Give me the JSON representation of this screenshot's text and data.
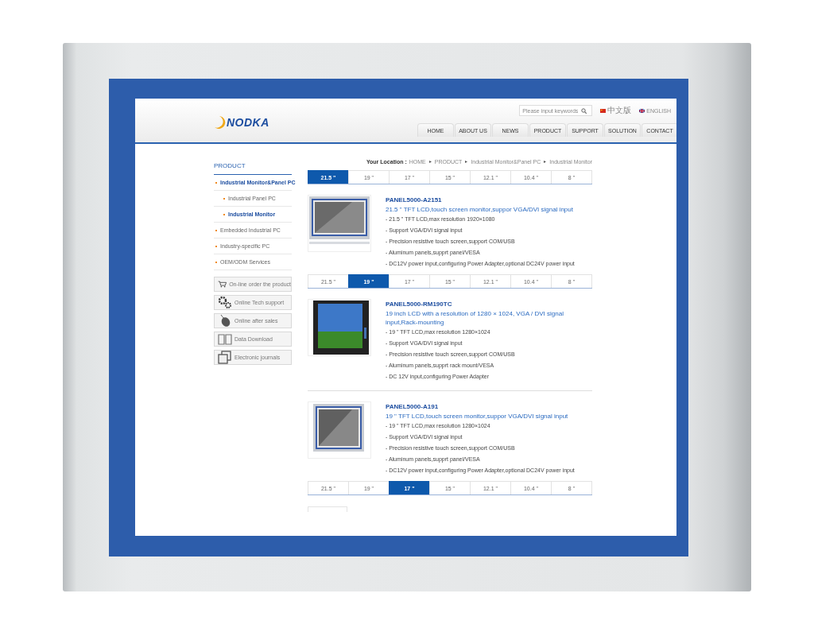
{
  "header": {
    "logo": "NODKA",
    "search": {
      "placeholder": "Please input keywords"
    },
    "languages": [
      {
        "label": "中文版"
      },
      {
        "label": "ENGLISH"
      }
    ],
    "nav": [
      {
        "label": "HOME",
        "selected": false
      },
      {
        "label": "ABOUT US",
        "selected": false
      },
      {
        "label": "NEWS",
        "selected": false
      },
      {
        "label": "PRODUCT",
        "selected": false
      },
      {
        "label": "SUPPORT",
        "selected": false
      },
      {
        "label": "SOLUTION",
        "selected": false
      },
      {
        "label": "CONTACT",
        "selected": false
      }
    ]
  },
  "sidebar": {
    "title": "PRODUCT",
    "items": [
      {
        "label": "Industrial Monitor&Panel PC",
        "selected": true,
        "children": [
          {
            "label": "Industrial Panel PC",
            "selected": false
          },
          {
            "label": "Industrial Monitor",
            "selected": true
          }
        ]
      },
      {
        "label": "Embedded Industrial PC",
        "selected": false
      },
      {
        "label": "Industry-specific PC",
        "selected": false
      },
      {
        "label": "OEM/ODM Services",
        "selected": false
      }
    ],
    "links": [
      {
        "label": "On-line order the product",
        "kind": "cart"
      },
      {
        "label": "Online Tech support",
        "kind": "gears"
      },
      {
        "label": "Online after sales",
        "kind": "mouse"
      },
      {
        "label": "Data Download",
        "kind": "book"
      },
      {
        "label": "Electronic journals",
        "kind": "pages"
      }
    ]
  },
  "breadcrumb": {
    "label": "Your Location :",
    "items": [
      "HOME",
      "PRODUCT",
      "Industrial Monitor&Panel PC",
      "Industrial Monitor"
    ]
  },
  "blocks": [
    {
      "kind": "tabs",
      "tabs": [
        {
          "label": "21.5 \"",
          "selected": true
        },
        {
          "label": "19 \"",
          "selected": false
        },
        {
          "label": "17 \"",
          "selected": false
        },
        {
          "label": "15 \"",
          "selected": false
        },
        {
          "label": "12.1 \"",
          "selected": false
        },
        {
          "label": "10.4 \"",
          "selected": false
        },
        {
          "label": "8 \"",
          "selected": false
        }
      ]
    },
    {
      "kind": "product",
      "model": "PANEL5000-A2151",
      "title": "21.5 \" TFT LCD,touch screen monitor,suppor VGA/DVI signal input",
      "specs": [
        "- 21.5 \" TFT LCD,max resolution 1920×1080",
        "- Support VGA/DVI signal input",
        "- Precision resistive touch screen,support COM/USB",
        "- Aluminum panels,supprt panel/VESA",
        "- DC12V power input,configuring Power Adapter,optional DC24V power input"
      ]
    },
    {
      "kind": "tabs",
      "tabs": [
        {
          "label": "21.5 \"",
          "selected": false
        },
        {
          "label": "19 \"",
          "selected": true
        },
        {
          "label": "17 \"",
          "selected": false
        },
        {
          "label": "15 \"",
          "selected": false
        },
        {
          "label": "12.1 \"",
          "selected": false
        },
        {
          "label": "10.4 \"",
          "selected": false
        },
        {
          "label": "8 \"",
          "selected": false
        }
      ]
    },
    {
      "kind": "product",
      "model": "PANEL5000-RM190TC",
      "title": "19 inch LCD with a resolution of 1280 × 1024, VGA / DVI signal input,Rack-mounting",
      "specs": [
        "- 19 \" TFT LCD,max resolution 1280×1024",
        "- Support VGA/DVI signal input",
        "- Precision resistive touch screen,support COM/USB",
        "- Aluminum panels,supprt rack mount/VESA",
        "- DC 12V input,configuring Power Adapter"
      ]
    },
    {
      "kind": "rule"
    },
    {
      "kind": "product",
      "model": "PANEL5000-A191",
      "title": "19 \" TFT LCD,touch screen monitor,suppor VGA/DVI signal input",
      "specs": [
        "- 19 \" TFT LCD,max resolution 1280×1024",
        "- Support VGA/DVI signal input",
        "- Precision resistive touch screen,support COM/USB",
        "- Aluminum panels,supprt panel/VESA",
        "- DC12V power input,configuring Power Adapter,optional DC24V power input"
      ]
    },
    {
      "kind": "tabs",
      "tabs": [
        {
          "label": "21.5 \"",
          "selected": false
        },
        {
          "label": "19 \"",
          "selected": false
        },
        {
          "label": "17 \"",
          "selected": true
        },
        {
          "label": "15 \"",
          "selected": false
        },
        {
          "label": "12.1 \"",
          "selected": false
        },
        {
          "label": "10.4 \"",
          "selected": false
        },
        {
          "label": "8 \"",
          "selected": false
        }
      ]
    }
  ]
}
